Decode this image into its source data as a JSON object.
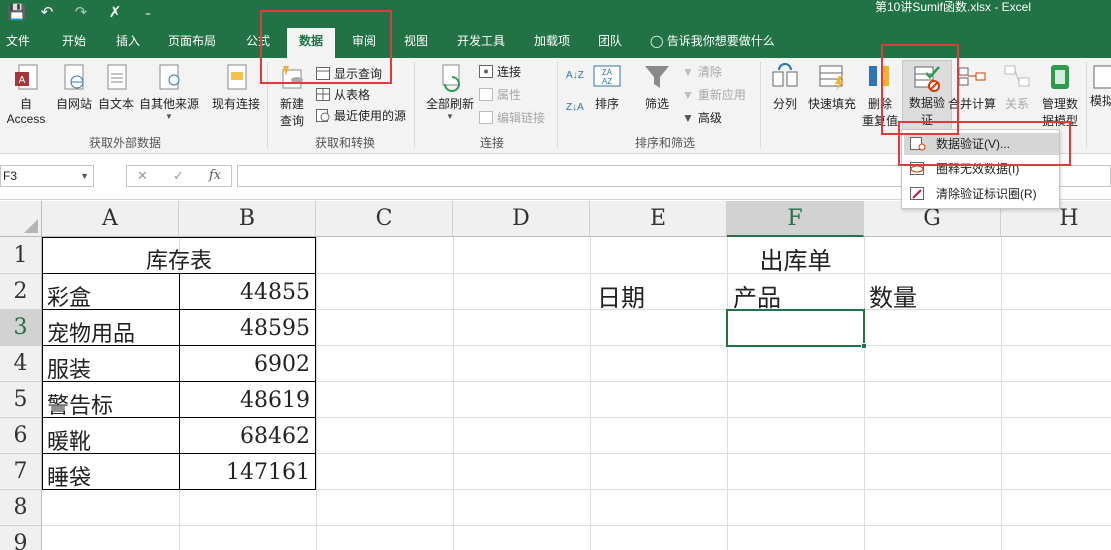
{
  "titlebar": {
    "save_icon": "💾",
    "undo_icon": "↶",
    "redo_icon": "↷",
    "custom_icon": "✗",
    "customize_icon": "₌",
    "title": "第10讲Sumif函数.xlsx  -  Excel"
  },
  "tabs": [
    "文件",
    "开始",
    "插入",
    "页面布局",
    "公式",
    "数据",
    "审阅",
    "视图",
    "开发工具",
    "加载项",
    "团队"
  ],
  "active_tab": "数据",
  "tell_me": "告诉我你想要做什么",
  "ribbon": {
    "get_external": {
      "buttons": [
        "自 Access",
        "自网站",
        "自文本",
        "自其他来源",
        "现有连接"
      ],
      "label": "获取外部数据"
    },
    "get_transform": {
      "new_query_line1": "新建",
      "new_query_line2": "查询",
      "show_queries": "显示查询",
      "from_table": "从表格",
      "recent_sources": "最近使用的源",
      "label": "获取和转换"
    },
    "connections": {
      "refresh_all": "全部刷新",
      "connections": "连接",
      "properties": "属性",
      "edit_links": "编辑链接",
      "label": "连接"
    },
    "sort_filter": {
      "sort": "排序",
      "filter": "筛选",
      "clear": "清除",
      "reapply": "重新应用",
      "advanced": "高级",
      "label": "排序和筛选"
    },
    "data_tools": {
      "text_to_columns": "分列",
      "flash_fill": "快速填充",
      "remove_dup_line1": "删除",
      "remove_dup_line2": "重复值",
      "data_validation_line1": "数据验",
      "data_validation_line2": "证",
      "consolidate": "合并计算",
      "relationships": "关系",
      "manage_model_line1": "管理数",
      "manage_model_line2": "据模型",
      "whatif": "模拟"
    }
  },
  "dropdown": {
    "items": [
      "数据验证(V)...",
      "圈释无效数据(I)",
      "清除验证标识圈(R)"
    ]
  },
  "formula_bar": {
    "name_box": "F3",
    "cancel_icon": "✕",
    "enter_icon": "✓",
    "fx_icon": "fx",
    "value": ""
  },
  "grid": {
    "columns": [
      "A",
      "B",
      "C",
      "D",
      "E",
      "F",
      "G",
      "H"
    ],
    "rows": [
      "1",
      "2",
      "3",
      "4",
      "5",
      "6",
      "7",
      "8",
      "9"
    ],
    "active_column": "F",
    "active_row": "3",
    "inventory_title": "库存表",
    "inventory": [
      {
        "name": "彩盒",
        "qty": "44855"
      },
      {
        "name": "宠物用品",
        "qty": "48595"
      },
      {
        "name": "服装",
        "qty": "6902"
      },
      {
        "name": "警告标",
        "qty": "48619"
      },
      {
        "name": "暖靴",
        "qty": "68462"
      },
      {
        "name": "睡袋",
        "qty": "147161"
      }
    ],
    "outbound_title": "出库单",
    "outbound_headers": [
      "日期",
      "产品",
      "数量"
    ]
  },
  "colors": {
    "excel_green": "#217346",
    "highlight_red": "#e03a3a"
  }
}
